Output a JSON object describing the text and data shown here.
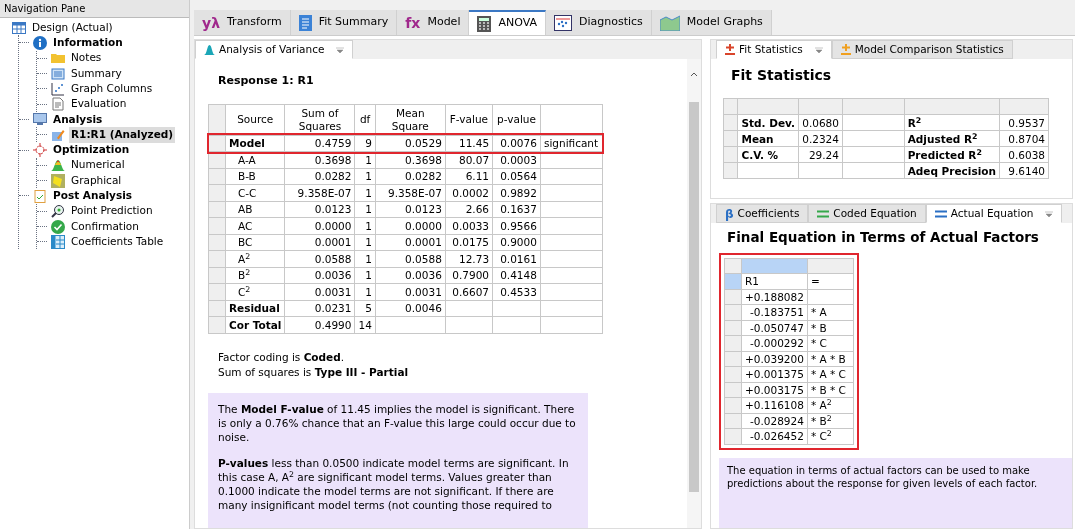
{
  "nav": {
    "title": "Navigation Pane",
    "tree": [
      {
        "label": "Design (Actual)",
        "bold": false,
        "selected": false,
        "children": [
          {
            "label": "Information",
            "bold": true,
            "selected": false,
            "children": [
              {
                "label": "Notes",
                "bold": false,
                "selected": false
              },
              {
                "label": "Summary",
                "bold": false,
                "selected": false
              },
              {
                "label": "Graph Columns",
                "bold": false,
                "selected": false
              },
              {
                "label": "Evaluation",
                "bold": false,
                "selected": false
              }
            ]
          },
          {
            "label": "Analysis",
            "bold": true,
            "selected": false,
            "children": [
              {
                "label": "R1:R1 (Analyzed)",
                "bold": true,
                "selected": true
              }
            ]
          },
          {
            "label": "Optimization",
            "bold": true,
            "selected": false,
            "children": [
              {
                "label": "Numerical",
                "bold": false,
                "selected": false
              },
              {
                "label": "Graphical",
                "bold": false,
                "selected": false
              }
            ]
          },
          {
            "label": "Post Analysis",
            "bold": true,
            "selected": false,
            "children": [
              {
                "label": "Point Prediction",
                "bold": false,
                "selected": false
              },
              {
                "label": "Confirmation",
                "bold": false,
                "selected": false
              },
              {
                "label": "Coefficients Table",
                "bold": false,
                "selected": false
              }
            ]
          }
        ]
      }
    ]
  },
  "tabs": [
    {
      "label": "Transform",
      "symbol": "yλ",
      "selected": false
    },
    {
      "label": "Fit Summary",
      "selected": false
    },
    {
      "label": "Model",
      "symbol": "fx",
      "selected": false
    },
    {
      "label": "ANOVA",
      "selected": true
    },
    {
      "label": "Diagnostics",
      "selected": false
    },
    {
      "label": "Model Graphs",
      "selected": false
    }
  ],
  "anova": {
    "tab": {
      "label": "Analysis of Variance",
      "selected": true
    },
    "heading": "Response 1: R1",
    "columns": [
      "Source",
      "Sum of Squares",
      "df",
      "Mean Square",
      "F-value",
      "p-value"
    ],
    "rows": [
      {
        "cells": [
          "Model",
          "0.4759",
          "9",
          "0.0529",
          "11.45",
          "0.0076",
          "significant"
        ],
        "bold": true,
        "highlighted": true
      },
      {
        "cells": [
          "A-A",
          "0.3698",
          "1",
          "0.3698",
          "80.07",
          "0.0003",
          ""
        ],
        "bold": false,
        "highlighted": false
      },
      {
        "cells": [
          "B-B",
          "0.0282",
          "1",
          "0.0282",
          "6.11",
          "0.0564",
          ""
        ],
        "bold": false,
        "highlighted": false
      },
      {
        "cells": [
          "C-C",
          "9.358E-07",
          "1",
          "9.358E-07",
          "0.0002",
          "0.9892",
          ""
        ],
        "bold": false,
        "highlighted": false
      },
      {
        "cells": [
          "AB",
          "0.0123",
          "1",
          "0.0123",
          "2.66",
          "0.1637",
          ""
        ],
        "bold": false,
        "highlighted": false
      },
      {
        "cells": [
          "AC",
          "0.0000",
          "1",
          "0.0000",
          "0.0033",
          "0.9566",
          ""
        ],
        "bold": false,
        "highlighted": false
      },
      {
        "cells": [
          "BC",
          "0.0001",
          "1",
          "0.0001",
          "0.0175",
          "0.9000",
          ""
        ],
        "bold": false,
        "highlighted": false
      },
      {
        "cells": [
          "A$^{2}$",
          "0.0588",
          "1",
          "0.0588",
          "12.73",
          "0.0161",
          ""
        ],
        "bold": false,
        "highlighted": false
      },
      {
        "cells": [
          "B$^{2}$",
          "0.0036",
          "1",
          "0.0036",
          "0.7900",
          "0.4148",
          ""
        ],
        "bold": false,
        "highlighted": false
      },
      {
        "cells": [
          "C$^{2}$",
          "0.0031",
          "1",
          "0.0031",
          "0.6607",
          "0.4533",
          ""
        ],
        "bold": false,
        "highlighted": false
      },
      {
        "cells": [
          "Residual",
          "0.0231",
          "5",
          "0.0046",
          "",
          "",
          ""
        ],
        "bold": true,
        "highlighted": false
      },
      {
        "cells": [
          "Cor Total",
          "0.4990",
          "14",
          "",
          "",
          "",
          ""
        ],
        "bold": true,
        "highlighted": false
      }
    ],
    "notes": [
      "Factor coding is **Coded**.",
      "Sum of squares is **Type III - Partial**"
    ],
    "explanation": [
      "The **Model F-value** of 11.45 implies the model is significant. There is only a 0.76% chance that an F-value this large could occur due to noise.",
      "**P-values** less than 0.0500 indicate model terms are significant. In this case A, A$^{2}$ are significant model terms. Values greater than 0.1000 indicate the model terms are not significant. If there are many insignificant model terms (not counting those required to"
    ]
  },
  "fit": {
    "tabs": [
      {
        "label": "Fit Statistics",
        "color": "#d9452b",
        "selected": true
      },
      {
        "label": "Model Comparison Statistics",
        "color": "#f0a020",
        "selected": false
      }
    ],
    "heading": "Fit Statistics",
    "rows": [
      [
        "Std. Dev.",
        "0.0680",
        "",
        "R$^{2}$",
        "0.9537"
      ],
      [
        "Mean",
        "0.2324",
        "",
        "Adjusted R$^{2}$",
        "0.8704"
      ],
      [
        "C.V. %",
        "29.24",
        "",
        "Predicted R$^{2}$",
        "0.6038"
      ],
      [
        "",
        "",
        "",
        "Adeq Precision",
        "9.6140"
      ]
    ]
  },
  "equation": {
    "tabs": [
      {
        "label": "Coefficients",
        "symbol": "β",
        "selected": false
      },
      {
        "label": "Coded Equation",
        "selected": false
      },
      {
        "label": "Actual Equation",
        "selected": true
      }
    ],
    "heading": "Final Equation in Terms of Actual Factors",
    "highlighted": true,
    "rows": [
      {
        "cells": [
          "R1",
          "="
        ],
        "selected": true
      },
      {
        "cells": [
          "+0.188082",
          ""
        ],
        "selected": false
      },
      {
        "cells": [
          "-0.183751",
          "* A"
        ],
        "selected": false
      },
      {
        "cells": [
          "-0.050747",
          "* B"
        ],
        "selected": false
      },
      {
        "cells": [
          "-0.000292",
          "* C"
        ],
        "selected": false
      },
      {
        "cells": [
          "+0.039200",
          "* A * B"
        ],
        "selected": false
      },
      {
        "cells": [
          "+0.001375",
          "* A * C"
        ],
        "selected": false
      },
      {
        "cells": [
          "+0.003175",
          "* B * C"
        ],
        "selected": false
      },
      {
        "cells": [
          "+0.116108",
          "* A$^{2}$"
        ],
        "selected": false
      },
      {
        "cells": [
          "-0.028924",
          "* B$^{2}$"
        ],
        "selected": false
      },
      {
        "cells": [
          "-0.026452",
          "* C$^{2}$"
        ],
        "selected": false
      }
    ],
    "explanation": "The equation in terms of actual factors can be used to make predictions about the response for given levels of each factor."
  }
}
